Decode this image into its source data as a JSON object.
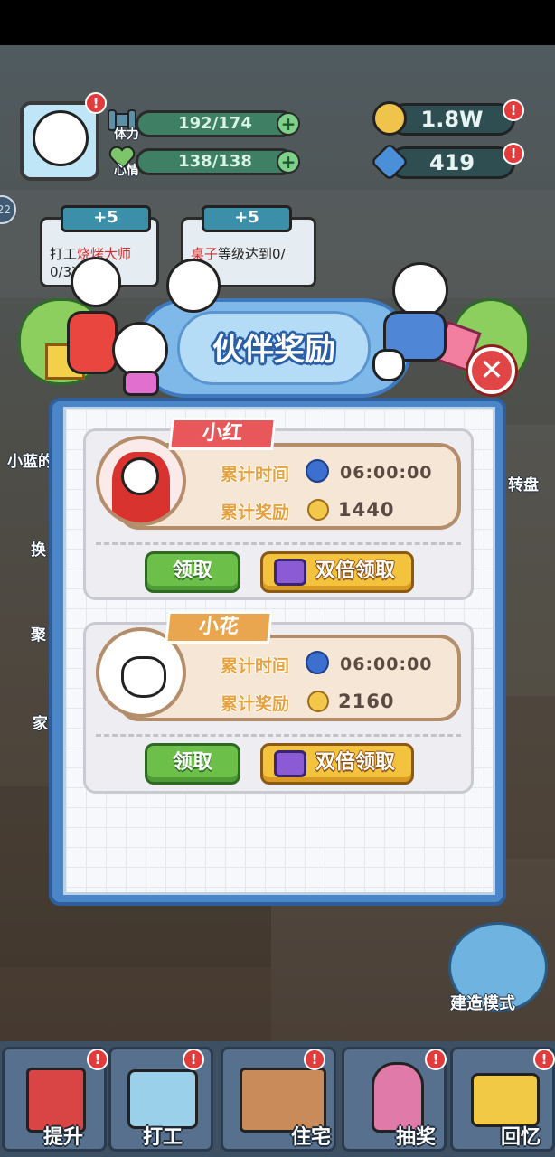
{
  "hud": {
    "stamina_label": "体力",
    "stamina_value": "192/174",
    "mood_label": "心情",
    "mood_value": "138/138",
    "plus": "+",
    "gold": "1.8W",
    "gems": "419",
    "badge": "!"
  },
  "side": {
    "left_badge": "22",
    "left_items": [
      "小蓝的",
      "换",
      "聚",
      "家"
    ],
    "right_items": [
      "转盘"
    ]
  },
  "tasks": [
    {
      "reward": "+5",
      "text_pre": "打工",
      "text_highlight": "烧烤大师",
      "text_post": "0/3次"
    },
    {
      "reward": "+5",
      "text_pre": "",
      "text_highlight": "桌子",
      "text_post": "等级达到0/"
    }
  ],
  "dialog": {
    "title": "伙伴奖励",
    "close": "✕",
    "companions": [
      {
        "name": "小红",
        "time_label": "累计时间",
        "time_value": "06:00:00",
        "reward_label": "累计奖励",
        "reward_value": "1440",
        "claim_label": "领取",
        "double_label": "双倍领取",
        "tag_color": "#e8585a"
      },
      {
        "name": "小花",
        "time_label": "累计时间",
        "time_value": "06:00:00",
        "reward_label": "累计奖励",
        "reward_value": "2160",
        "claim_label": "领取",
        "double_label": "双倍领取",
        "tag_color": "#e9a64e"
      }
    ]
  },
  "build_mode": "建造模式",
  "bottom_tabs": [
    {
      "label": "提升",
      "icon": "book-icon"
    },
    {
      "label": "打工",
      "icon": "tv-character-icon"
    },
    {
      "label": "住宅",
      "icon": "bed-icon"
    },
    {
      "label": "抽奖",
      "icon": "gacha-machine-icon"
    },
    {
      "label": "回忆",
      "icon": "camera-icon"
    }
  ]
}
